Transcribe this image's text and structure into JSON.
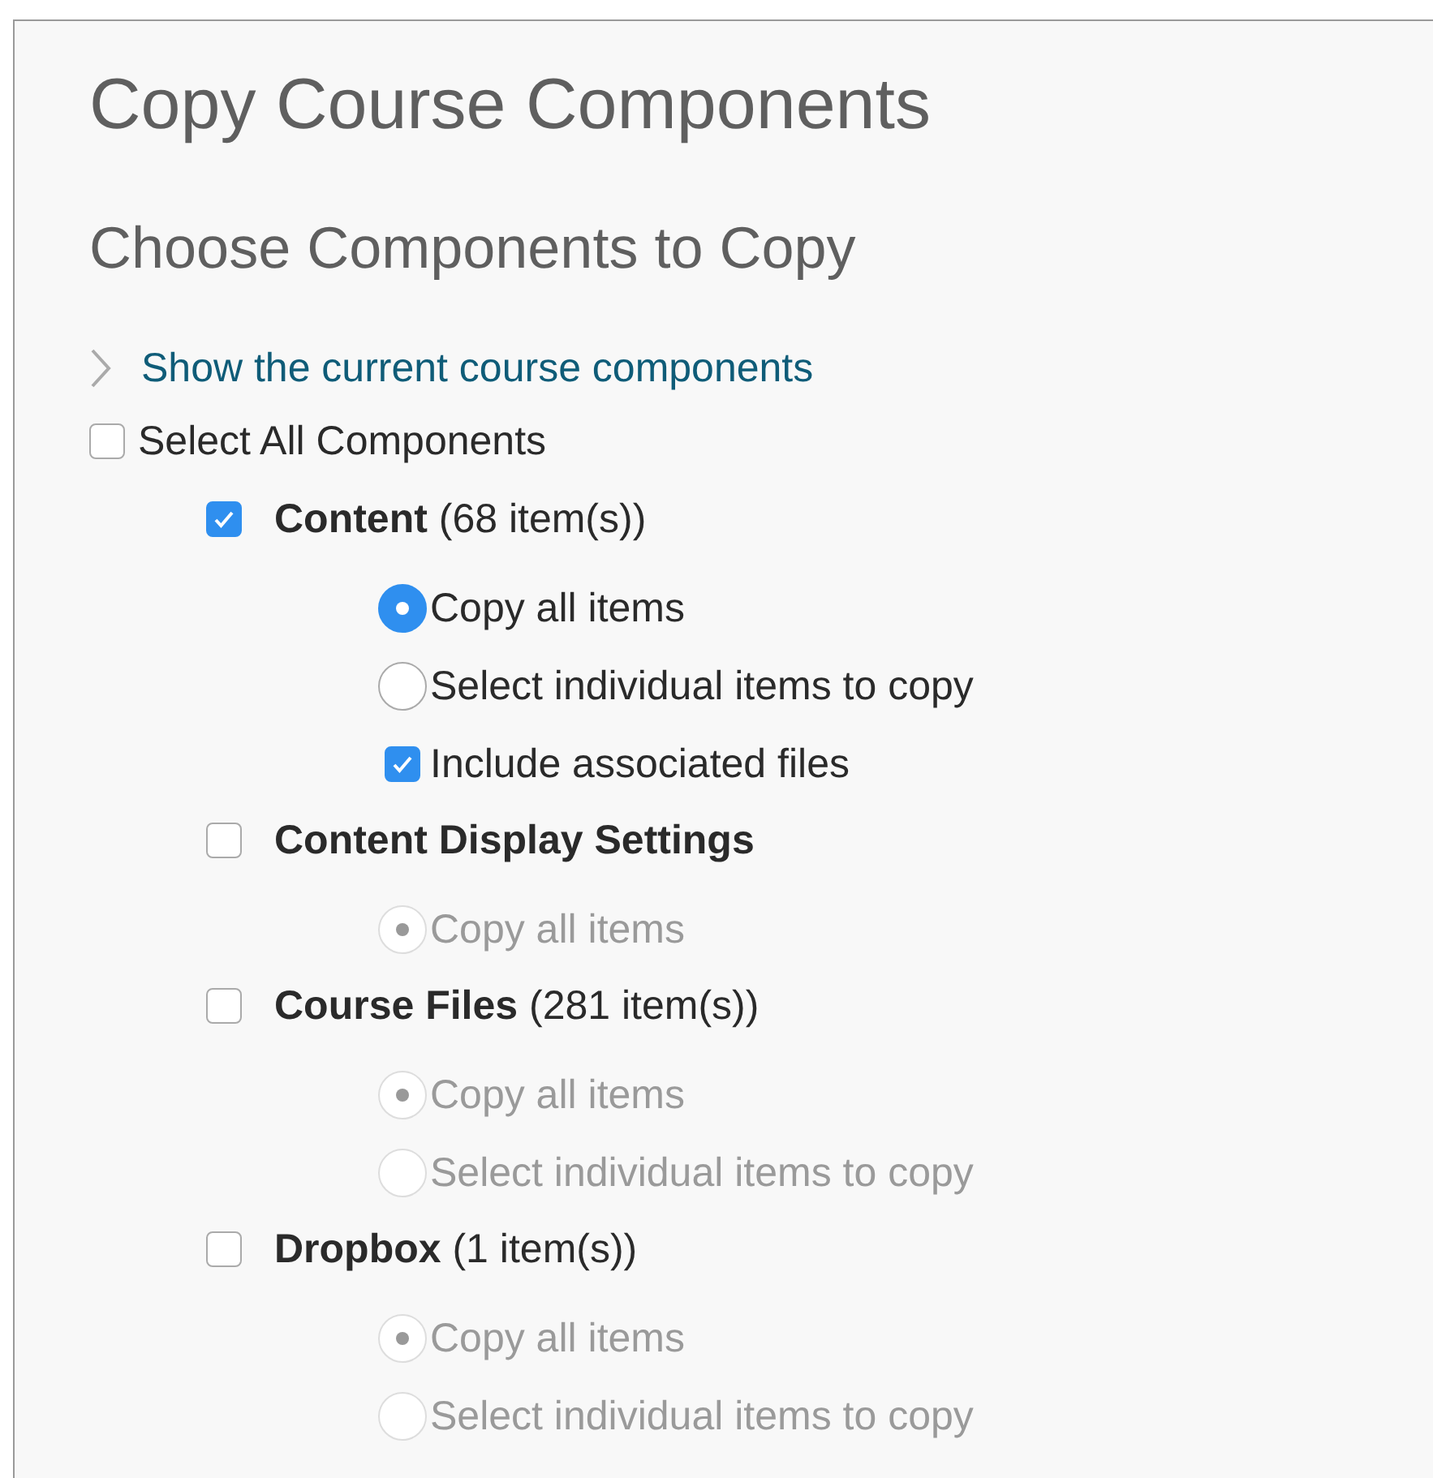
{
  "title": "Copy Course Components",
  "subtitle": "Choose Components to Copy",
  "toggle": {
    "label": "Show the current course components",
    "expanded": false
  },
  "select_all": {
    "label": "Select All Components",
    "checked": false
  },
  "components": [
    {
      "name": "Content",
      "count": "(68 item(s))",
      "checked": true,
      "options": [
        {
          "kind": "radio",
          "label": "Copy all items",
          "selected": true,
          "disabled": false
        },
        {
          "kind": "radio",
          "label": "Select individual items to copy",
          "selected": false,
          "disabled": false
        },
        {
          "kind": "checkbox",
          "label": "Include associated files",
          "checked": true,
          "disabled": false
        }
      ]
    },
    {
      "name": "Content Display Settings",
      "checked": false,
      "options": [
        {
          "kind": "radio",
          "label": "Copy all items",
          "selected": true,
          "disabled": true
        }
      ]
    },
    {
      "name": "Course Files",
      "count": "(281 item(s))",
      "checked": false,
      "options": [
        {
          "kind": "radio",
          "label": "Copy all items",
          "selected": true,
          "disabled": true
        },
        {
          "kind": "radio",
          "label": "Select individual items to copy",
          "selected": false,
          "disabled": true
        }
      ]
    },
    {
      "name": "Dropbox",
      "count": "(1 item(s))",
      "checked": false,
      "options": [
        {
          "kind": "radio",
          "label": "Copy all items",
          "selected": true,
          "disabled": true
        },
        {
          "kind": "radio",
          "label": "Select individual items to copy",
          "selected": false,
          "disabled": true
        }
      ]
    }
  ]
}
